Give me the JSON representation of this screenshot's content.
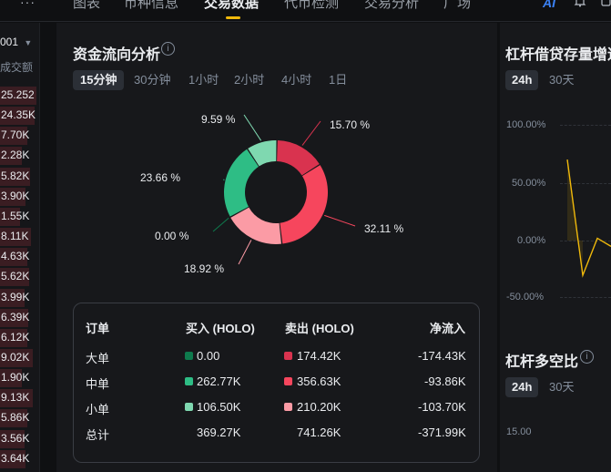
{
  "top_tabs": [
    {
      "label": "图表"
    },
    {
      "label": "币种信息"
    },
    {
      "label": "交易数据",
      "active": true
    },
    {
      "label": "代币检测"
    },
    {
      "label": "交易分析"
    },
    {
      "label": "广场"
    }
  ],
  "header_icons": {
    "ai": "AI",
    "bell": "bell-icon",
    "more": "more-icon"
  },
  "left_strip": {
    "selector_value": "001",
    "column_header": "成交额",
    "rows": [
      "25.252",
      "24.35K",
      "7.70K",
      "2.28K",
      "5.82K",
      "3.90K",
      "1.55K",
      "8.11K",
      "4.63K",
      "5.62K",
      "3.99K",
      "6.39K",
      "6.12K",
      "9.02K",
      "1.90K",
      "9.13K",
      "5.86K",
      "3.56K",
      "3.64K"
    ]
  },
  "capital_flow": {
    "title": "资金流向分析",
    "info_icon": "i",
    "period_tabs": [
      "15分钟",
      "30分钟",
      "1小时",
      "2小时",
      "4小时",
      "1日"
    ],
    "active_period": "15分钟",
    "donut_labels": [
      "15.70 %",
      "32.11 %",
      "18.92 %",
      "0.00 %",
      "23.66 %",
      "9.59 %"
    ]
  },
  "chart_data": {
    "type": "pie",
    "style": "donut",
    "slices": [
      {
        "name": "卖出大单",
        "value": 15.7,
        "color": "#d9334f"
      },
      {
        "name": "卖出中单",
        "value": 32.11,
        "color": "#f6465d"
      },
      {
        "name": "卖出小单",
        "value": 18.92,
        "color": "#fb9ba5"
      },
      {
        "name": "买入大单",
        "value": 0.0,
        "color": "#0e7a4d"
      },
      {
        "name": "买入中单",
        "value": 23.66,
        "color": "#2ebd85"
      },
      {
        "name": "买入小单",
        "value": 9.59,
        "color": "#7fd8b0"
      }
    ]
  },
  "orders_table": {
    "headers": {
      "order": "订单",
      "buy": "买入 (HOLO)",
      "sell": "卖出 (HOLO)",
      "net": "净流入"
    },
    "rows": [
      {
        "label": "大单",
        "buy": "0.00",
        "sell": "174.42K",
        "net": "-174.43K",
        "buy_color": "#0e7a4d",
        "sell_color": "#d9334f"
      },
      {
        "label": "中单",
        "buy": "262.77K",
        "sell": "356.63K",
        "net": "-93.86K",
        "buy_color": "#2ebd85",
        "sell_color": "#f6465d"
      },
      {
        "label": "小单",
        "buy": "106.50K",
        "sell": "210.20K",
        "net": "-103.70K",
        "buy_color": "#7fd8b0",
        "sell_color": "#fb9ba5"
      }
    ],
    "total": {
      "label": "总计",
      "buy": "369.27K",
      "sell": "741.26K",
      "net": "-371.99K"
    }
  },
  "leverage_lending": {
    "title": "杠杆借贷存量增速",
    "tabs": [
      "24h",
      "30天"
    ],
    "active_tab": "24h",
    "y_ticks": [
      "100.00%",
      "50.00%",
      "0.00%",
      "-50.00%"
    ],
    "line_color": "#f0b90b",
    "series_values": [
      70,
      -30,
      2,
      -5
    ]
  },
  "long_short_ratio": {
    "title": "杠杆多空比",
    "info_icon": "i",
    "tabs": [
      "24h",
      "30天"
    ],
    "active_tab": "24h",
    "y_ticks": [
      "15.00"
    ]
  }
}
